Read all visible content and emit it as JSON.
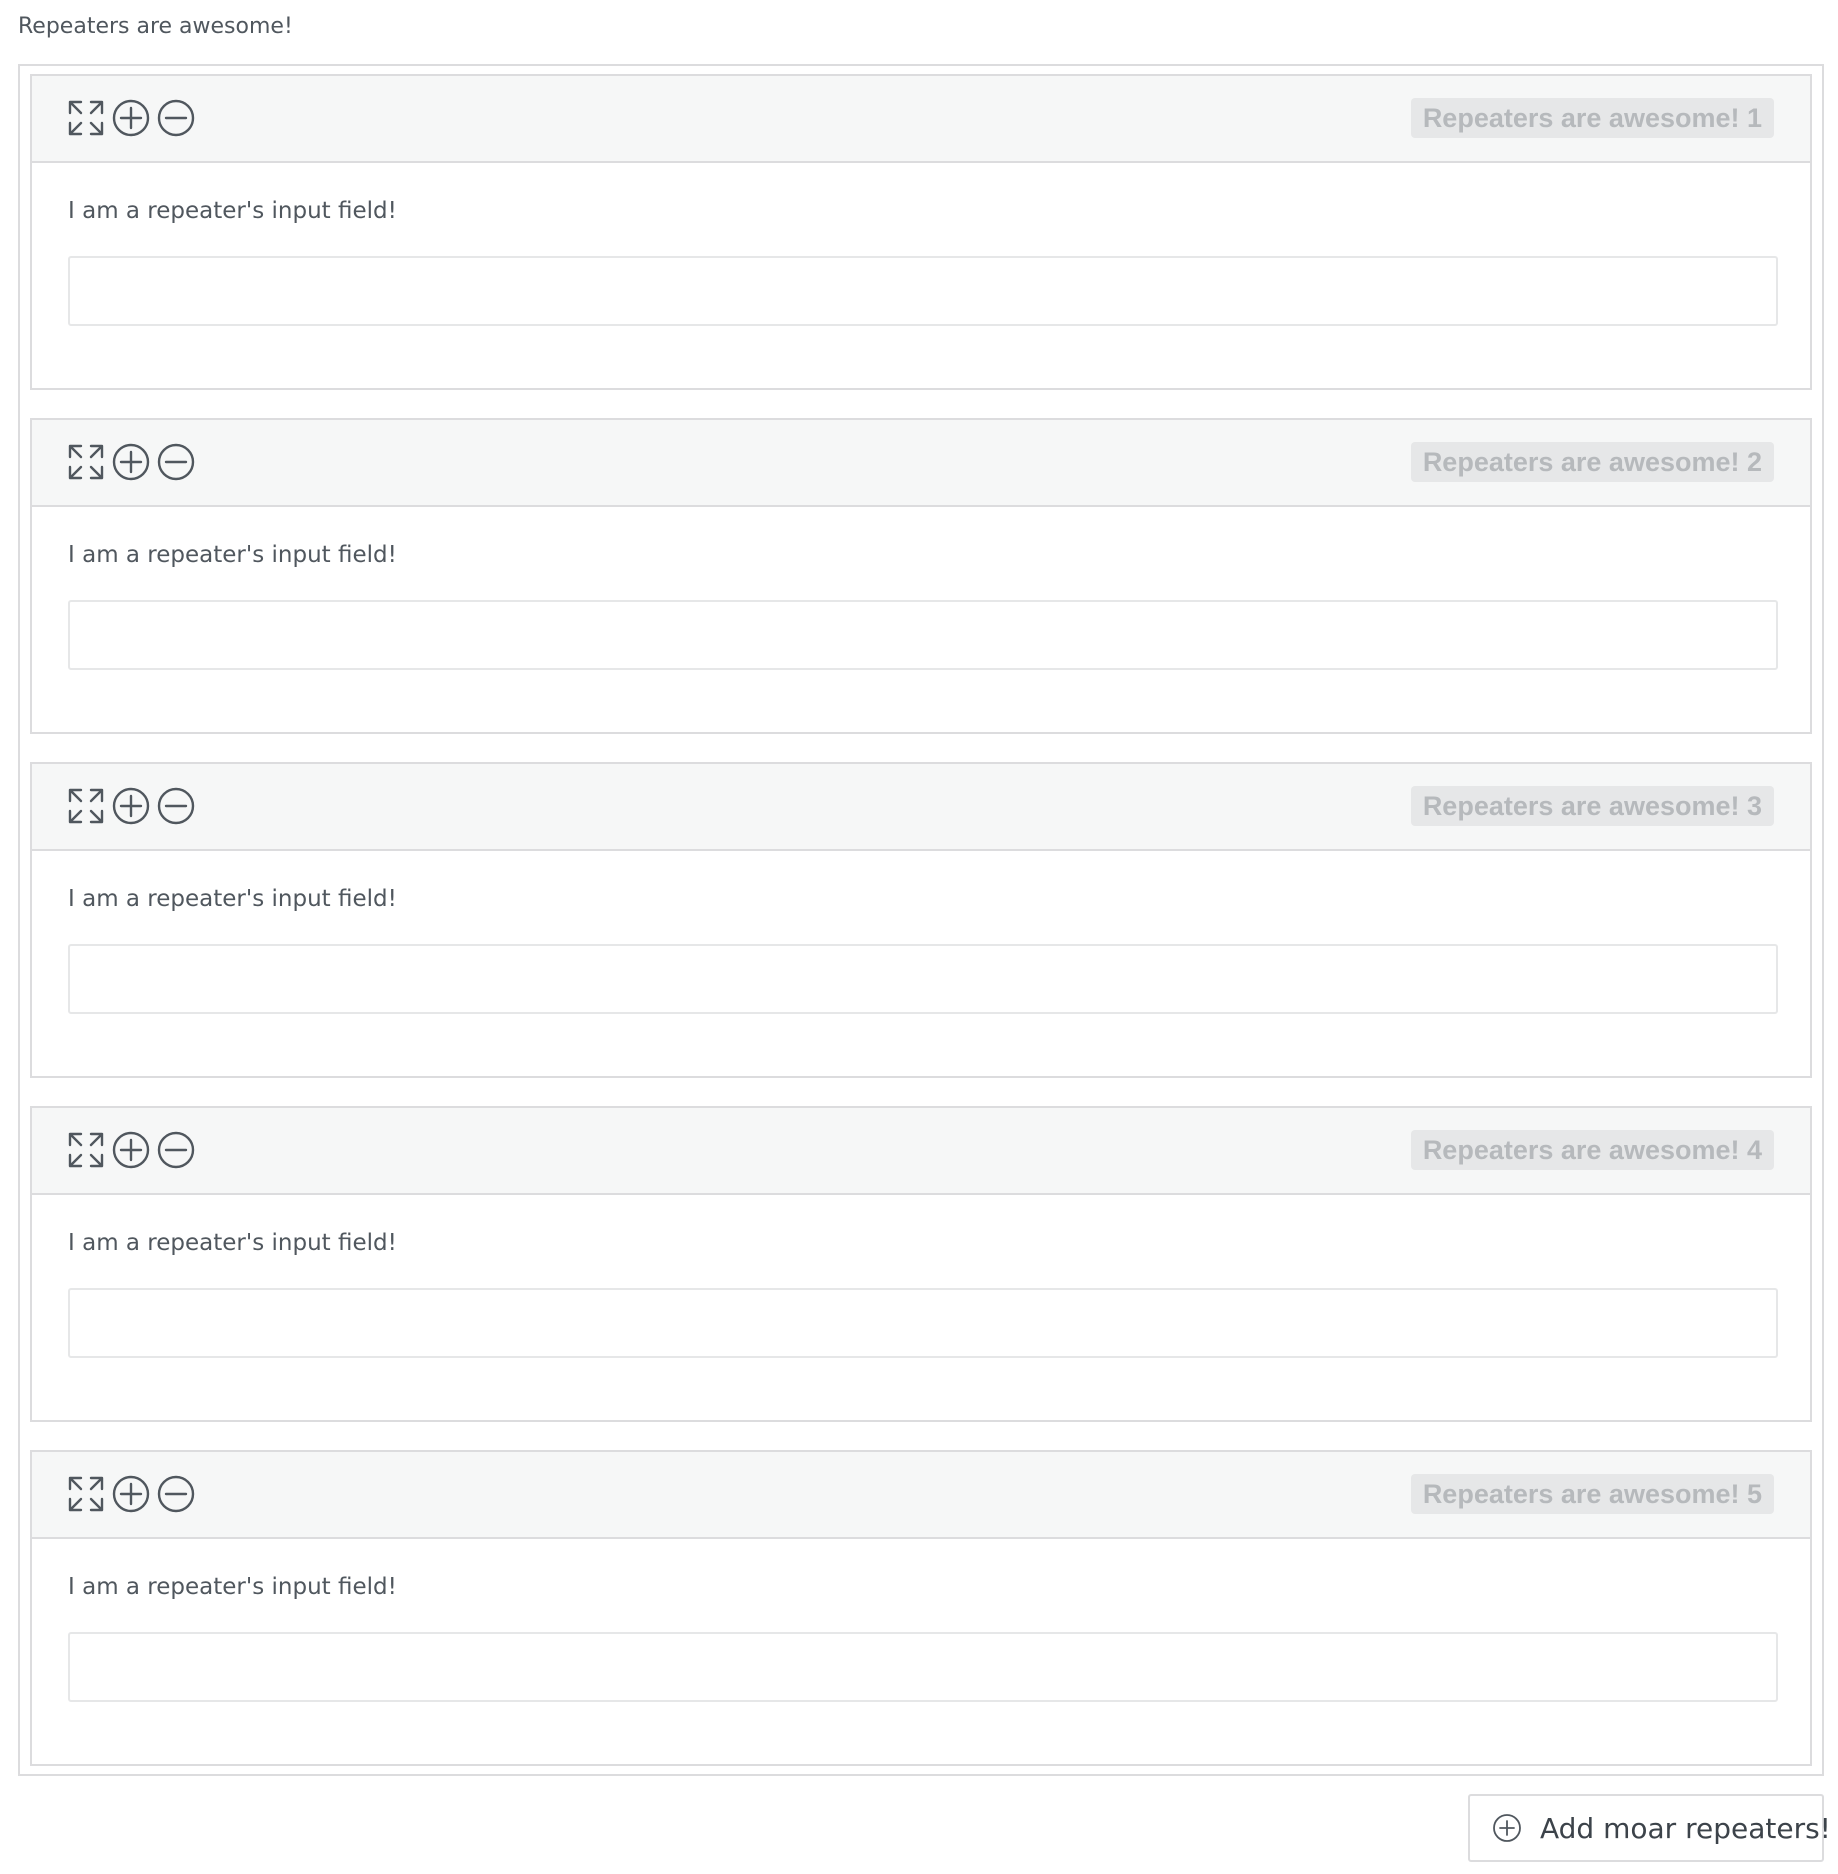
{
  "field_label": "Repeaters are awesome!",
  "colors": {
    "header_bg": "#f6f7f7",
    "border": "#dcdcde",
    "text": "#50575e",
    "title_text": "#b6b9bc"
  },
  "item_icons": [
    "expand-arrows-icon",
    "plus-circle-icon",
    "minus-circle-icon"
  ],
  "items": [
    {
      "title": "Repeaters are awesome! 1",
      "field_label": "I am a repeater's input field!",
      "value": ""
    },
    {
      "title": "Repeaters are awesome! 2",
      "field_label": "I am a repeater's input field!",
      "value": ""
    },
    {
      "title": "Repeaters are awesome! 3",
      "field_label": "I am a repeater's input field!",
      "value": ""
    },
    {
      "title": "Repeaters are awesome! 4",
      "field_label": "I am a repeater's input field!",
      "value": ""
    },
    {
      "title": "Repeaters are awesome! 5",
      "field_label": "I am a repeater's input field!",
      "value": ""
    }
  ],
  "add_button": {
    "label": "Add moar repeaters!",
    "icon": "plus-circle-icon"
  }
}
